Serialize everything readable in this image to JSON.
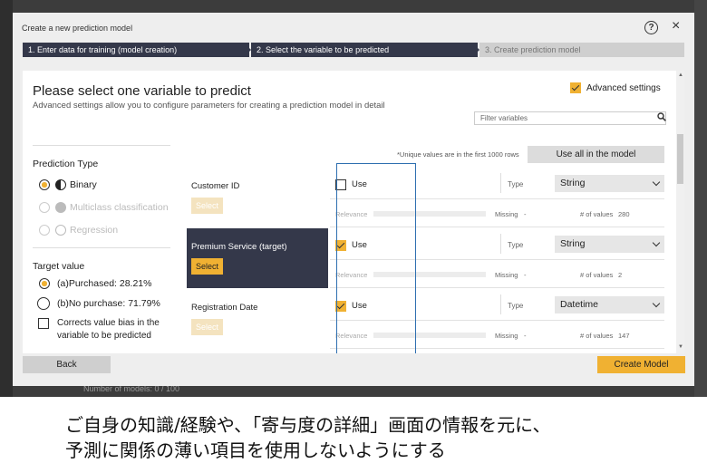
{
  "modal": {
    "title": "Create a new prediction model",
    "help_icon": "?",
    "close_icon": "×"
  },
  "steps": [
    {
      "label": "1. Enter data for training (model creation)"
    },
    {
      "label": "2. Select the variable to be predicted"
    },
    {
      "label": "3. Create prediction model"
    }
  ],
  "heading": "Please select one variable to predict",
  "subheading": "Advanced settings allow you to configure parameters for creating a prediction model in detail",
  "advanced_settings": {
    "label": "Advanced settings",
    "checked": true
  },
  "filter": {
    "placeholder": "Filter variables"
  },
  "prediction_type": {
    "title": "Prediction Type",
    "options": [
      {
        "label": "Binary",
        "selected": true,
        "enabled": true
      },
      {
        "label": "Multiclass classification",
        "selected": false,
        "enabled": false
      },
      {
        "label": "Regression",
        "selected": false,
        "enabled": false
      }
    ]
  },
  "target_value": {
    "title": "Target value",
    "options": [
      {
        "label": "(a)Purchased: 28.21%",
        "selected": true
      },
      {
        "label": "(b)No purchase: 71.79%",
        "selected": false
      }
    ],
    "correct_bias": {
      "label_line1": "Corrects value bias in the",
      "label_line2": "variable to be predicted",
      "checked": false
    }
  },
  "table": {
    "unique_note": "*Unique values are in the first 1000 rows",
    "use_all_label": "Use all in the model",
    "select_label": "Select",
    "use_label": "Use",
    "type_label": "Type",
    "relevance_label": "Relevance",
    "missing_label": "Missing",
    "num_values_label": "# of values",
    "rows": [
      {
        "name": "Customer ID",
        "use": false,
        "type": "String",
        "missing": "-",
        "num_values": "280",
        "active": false
      },
      {
        "name": "Premium Service (target)",
        "use": true,
        "type": "String",
        "missing": "-",
        "num_values": "2",
        "active": true
      },
      {
        "name": "Registration Date",
        "use": true,
        "type": "Datetime",
        "missing": "-",
        "num_values": "147",
        "active": false
      }
    ]
  },
  "buttons": {
    "back": "Back",
    "create": "Create Model"
  },
  "background": {
    "models_count": "Number of models: 0 / 100"
  },
  "caption": {
    "line1": "ご自身の知識/経験や、「寄与度の詳細」画面の情報を元に、",
    "line2": "予測に関係の薄い項目を使用しないようにする"
  },
  "colors": {
    "accent": "#f0b132",
    "navy": "#34384a",
    "highlight_box": "#2e6fb0"
  }
}
